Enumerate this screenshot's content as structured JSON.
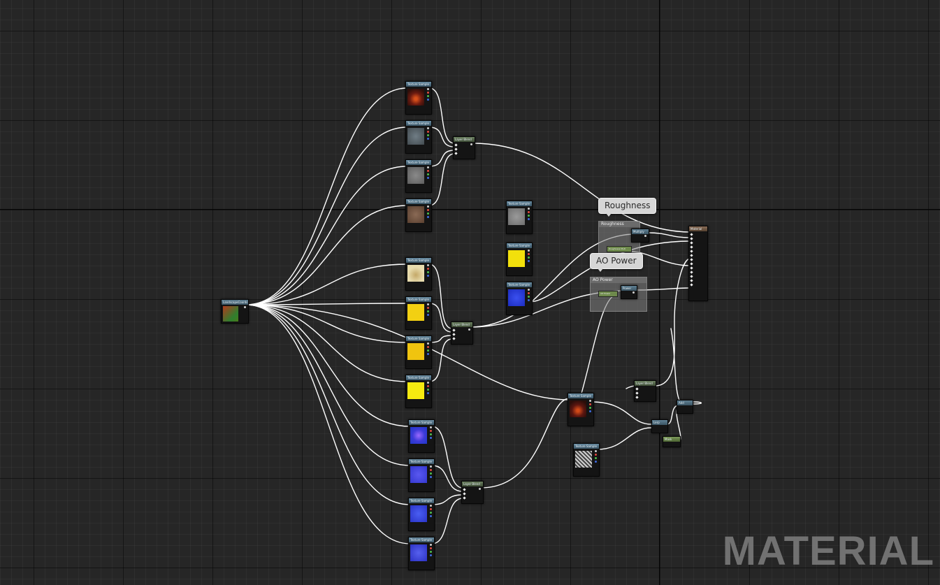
{
  "comments": {
    "roughness": "Roughness",
    "ao_power": "AO Power"
  },
  "groups": {
    "roughness": "Roughness",
    "ao_power": "AO Power"
  },
  "nodes": {
    "texture_sample": "Texture Sample",
    "layer_blend": "Layer Blend",
    "landscape_coords": "LandscapeCoords",
    "multiply": "Multiply",
    "power": "Power",
    "output": "Material",
    "roughness_mult": "Roughness Mult",
    "ao_power_param": "AO Power",
    "lerp": "Lerp",
    "add": "Add",
    "mask": "Mask"
  },
  "watermark": "MATERIAL",
  "colors": {
    "background": "#262626",
    "wire": "#ffffff",
    "node_header": "#4a6778",
    "comment_bubble": "#d6d6d6"
  },
  "icons": {
    "pin_red": "pin-red-icon",
    "pin_green": "pin-green-icon",
    "pin_blue": "pin-blue-icon",
    "exec_pin": "input-pin-icon"
  }
}
